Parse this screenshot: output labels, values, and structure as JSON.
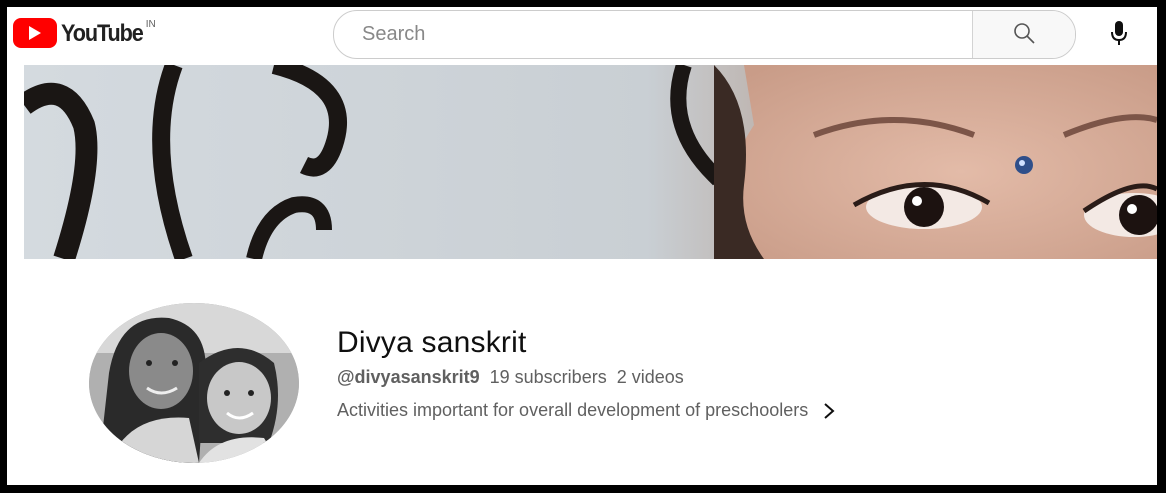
{
  "header": {
    "logo_text": "YouTube",
    "country_code": "IN",
    "search": {
      "placeholder": "Search"
    }
  },
  "channel": {
    "name": "Divya sanskrit",
    "handle": "@divyasanskrit9",
    "subscribers": "19 subscribers",
    "videos": "2 videos",
    "description": "Activities important for overall development of preschoolers"
  },
  "icons": {
    "logo": "youtube-logo-icon",
    "search": "search-icon",
    "mic": "microphone-icon",
    "more": "chevron-right-icon"
  },
  "colors": {
    "brand_red": "#ff0000",
    "text_primary": "#0f0f0f",
    "text_secondary": "#606060"
  }
}
